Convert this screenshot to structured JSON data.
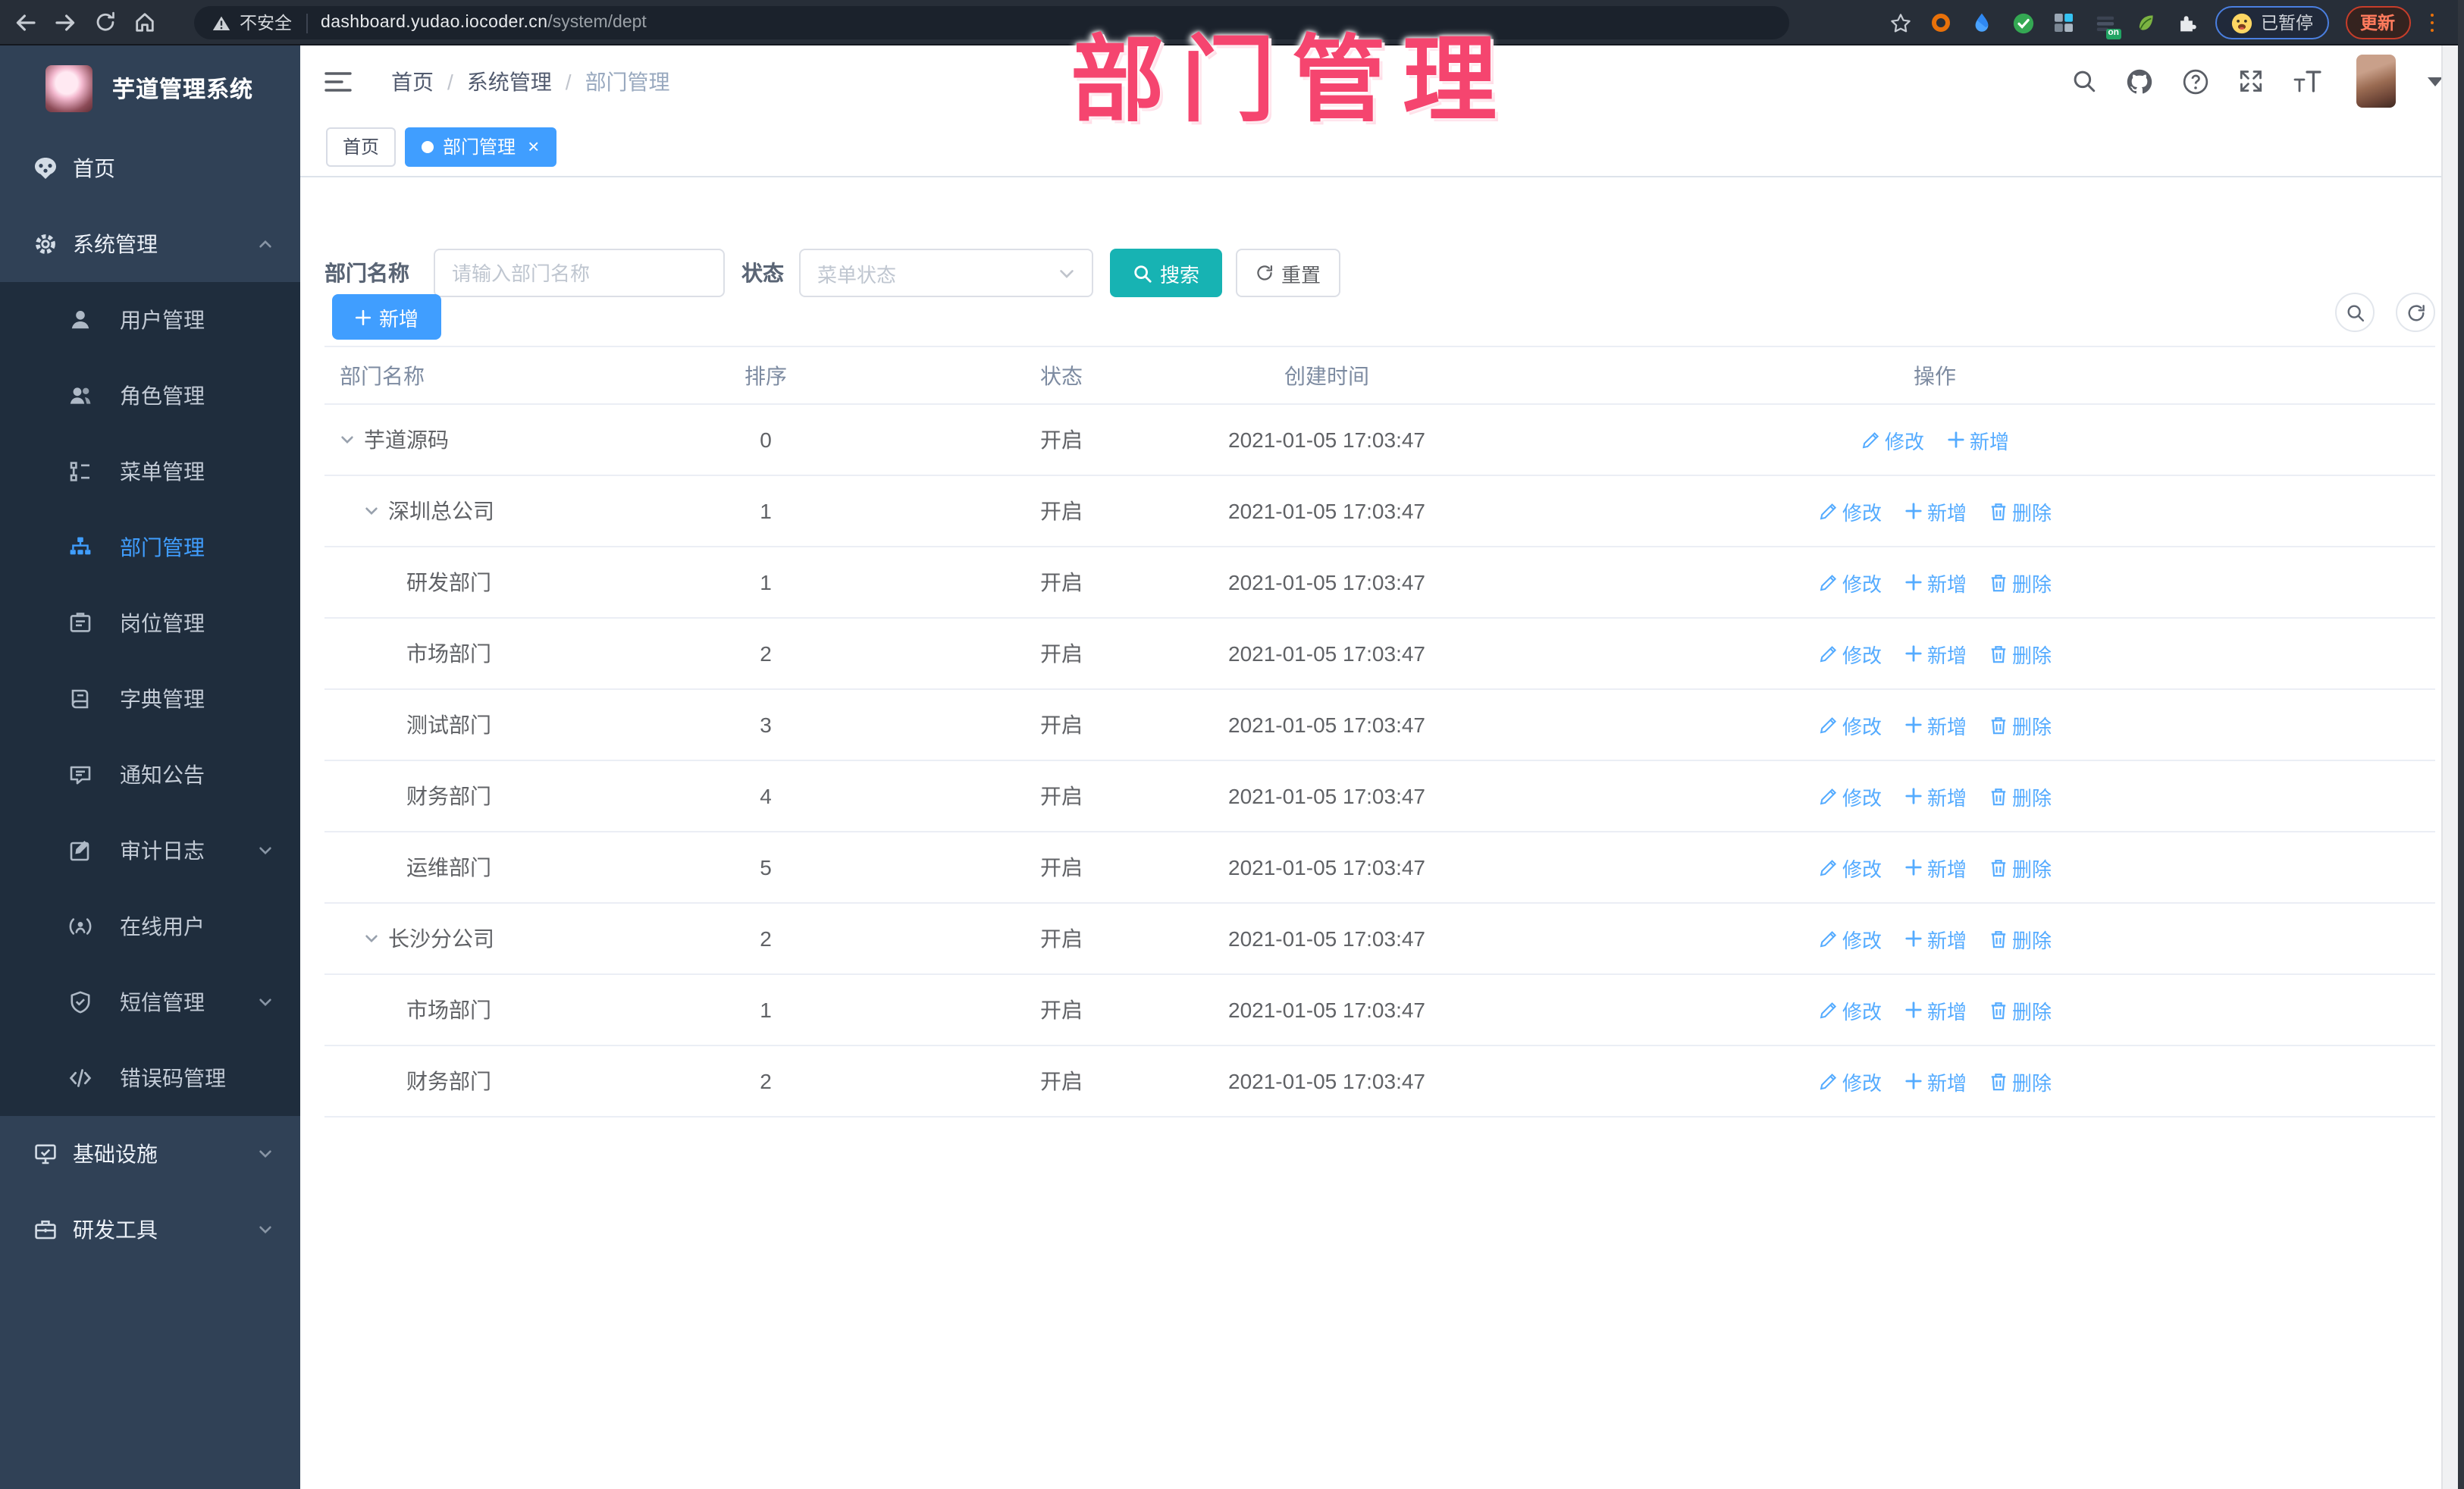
{
  "browser": {
    "security_label": "不安全",
    "url_host": "dashboard.yudao.iocoder.cn",
    "url_path": "/system/dept",
    "paused_label": "已暂停",
    "update_label": "更新",
    "ext_badge_label": "on"
  },
  "sidebar": {
    "app_title": "芋道管理系统",
    "items": [
      {
        "key": "home",
        "icon": "dashboard-icon",
        "label": "首页"
      },
      {
        "key": "system",
        "icon": "gear-icon",
        "label": "系统管理",
        "caret": "up"
      },
      {
        "key": "user",
        "icon": "user-icon",
        "label": "用户管理",
        "sub": true
      },
      {
        "key": "role",
        "icon": "users-icon",
        "label": "角色管理",
        "sub": true
      },
      {
        "key": "menu",
        "icon": "menu-tree-icon",
        "label": "菜单管理",
        "sub": true
      },
      {
        "key": "dept",
        "icon": "org-tree-icon",
        "label": "部门管理",
        "sub": true,
        "active": true
      },
      {
        "key": "post",
        "icon": "badge-icon",
        "label": "岗位管理",
        "sub": true
      },
      {
        "key": "dict",
        "icon": "dict-icon",
        "label": "字典管理",
        "sub": true
      },
      {
        "key": "notice",
        "icon": "notice-icon",
        "label": "通知公告",
        "sub": true
      },
      {
        "key": "audit-log",
        "icon": "audit-icon",
        "label": "审计日志",
        "sub": true,
        "caret": "down"
      },
      {
        "key": "online-user",
        "icon": "online-user-icon",
        "label": "在线用户",
        "sub": true
      },
      {
        "key": "sms",
        "icon": "sms-icon",
        "label": "短信管理",
        "sub": true,
        "caret": "down"
      },
      {
        "key": "error-code",
        "icon": "error-code-icon",
        "label": "错误码管理",
        "sub": true
      },
      {
        "key": "infra",
        "icon": "infra-icon",
        "label": "基础设施",
        "caret": "down"
      },
      {
        "key": "dev-tools",
        "icon": "tools-icon",
        "label": "研发工具",
        "caret": "down"
      }
    ]
  },
  "header": {
    "breadcrumb": [
      "首页",
      "系统管理",
      "部门管理"
    ]
  },
  "tabs": [
    {
      "label": "首页",
      "active": false,
      "closable": false
    },
    {
      "label": "部门管理",
      "active": true,
      "closable": true
    }
  ],
  "watermark": "部门管理",
  "filters": {
    "name_label": "部门名称",
    "name_placeholder": "请输入部门名称",
    "status_label": "状态",
    "status_placeholder": "菜单状态",
    "search_label": "搜索",
    "reset_label": "重置"
  },
  "toolbar": {
    "add_label": "新增"
  },
  "table": {
    "columns": [
      "部门名称",
      "排序",
      "状态",
      "创建时间",
      "操作"
    ],
    "op_labels": {
      "edit": "修改",
      "add": "新增",
      "delete": "删除"
    },
    "rows": [
      {
        "name": "芋道源码",
        "level": 0,
        "expandable": true,
        "sort": "0",
        "status": "开启",
        "time": "2021-01-05 17:03:47",
        "ops": [
          "edit",
          "add"
        ]
      },
      {
        "name": "深圳总公司",
        "level": 1,
        "expandable": true,
        "sort": "1",
        "status": "开启",
        "time": "2021-01-05 17:03:47",
        "ops": [
          "edit",
          "add",
          "delete"
        ]
      },
      {
        "name": "研发部门",
        "level": 2,
        "expandable": false,
        "sort": "1",
        "status": "开启",
        "time": "2021-01-05 17:03:47",
        "ops": [
          "edit",
          "add",
          "delete"
        ]
      },
      {
        "name": "市场部门",
        "level": 2,
        "expandable": false,
        "sort": "2",
        "status": "开启",
        "time": "2021-01-05 17:03:47",
        "ops": [
          "edit",
          "add",
          "delete"
        ]
      },
      {
        "name": "测试部门",
        "level": 2,
        "expandable": false,
        "sort": "3",
        "status": "开启",
        "time": "2021-01-05 17:03:47",
        "ops": [
          "edit",
          "add",
          "delete"
        ]
      },
      {
        "name": "财务部门",
        "level": 2,
        "expandable": false,
        "sort": "4",
        "status": "开启",
        "time": "2021-01-05 17:03:47",
        "ops": [
          "edit",
          "add",
          "delete"
        ]
      },
      {
        "name": "运维部门",
        "level": 2,
        "expandable": false,
        "sort": "5",
        "status": "开启",
        "time": "2021-01-05 17:03:47",
        "ops": [
          "edit",
          "add",
          "delete"
        ]
      },
      {
        "name": "长沙分公司",
        "level": 1,
        "expandable": true,
        "sort": "2",
        "status": "开启",
        "time": "2021-01-05 17:03:47",
        "ops": [
          "edit",
          "add",
          "delete"
        ]
      },
      {
        "name": "市场部门",
        "level": 2,
        "expandable": false,
        "sort": "1",
        "status": "开启",
        "time": "2021-01-05 17:03:47",
        "ops": [
          "edit",
          "add",
          "delete"
        ]
      },
      {
        "name": "财务部门",
        "level": 2,
        "expandable": false,
        "sort": "2",
        "status": "开启",
        "time": "2021-01-05 17:03:47",
        "ops": [
          "edit",
          "add",
          "delete"
        ]
      }
    ]
  },
  "colors": {
    "accent": "#409eff",
    "search_button": "#17b3b3",
    "link": "#54abff",
    "watermark": "#f5456f",
    "sidebar_bg": "#304156",
    "submenu_bg": "#1f2d3d",
    "chrome_bg": "#272e38"
  }
}
